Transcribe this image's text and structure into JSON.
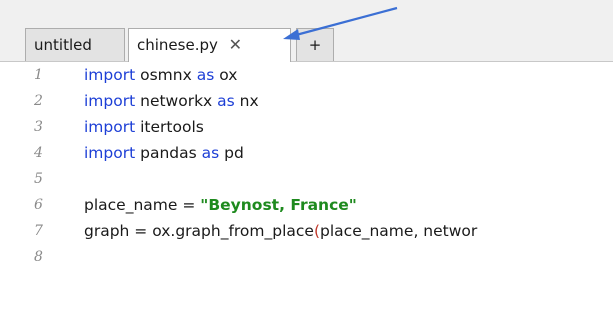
{
  "tabs": {
    "untitled": "untitled",
    "active": "chinese.py",
    "close_glyph": "✕",
    "add": "+"
  },
  "lines": [
    {
      "n": "1",
      "kw1": "import",
      "t1": " osmnx ",
      "kw2": "as",
      "t2": " ox"
    },
    {
      "n": "2",
      "kw1": "import",
      "t1": " networkx ",
      "kw2": "as",
      "t2": " nx"
    },
    {
      "n": "3",
      "kw1": "import",
      "t1": " itertools",
      "kw2": "",
      "t2": ""
    },
    {
      "n": "4",
      "kw1": "import",
      "t1": " pandas ",
      "kw2": "as",
      "t2": " pd"
    },
    {
      "n": "5"
    },
    {
      "n": "6",
      "t1": "place_name = ",
      "str": "\"Beynost, France\""
    },
    {
      "n": "7",
      "t1": "graph = ox.graph_from_place",
      "par": "(",
      "t2": "place_name, networ"
    },
    {
      "n": "8"
    }
  ],
  "colors": {
    "keyword": "#1d3fd6",
    "string": "#1e8a1e",
    "paren": "#c0392b",
    "arrow": "#3b6fd4"
  },
  "icons": {
    "tab_close": "close-icon",
    "annotation": "arrow-icon"
  }
}
